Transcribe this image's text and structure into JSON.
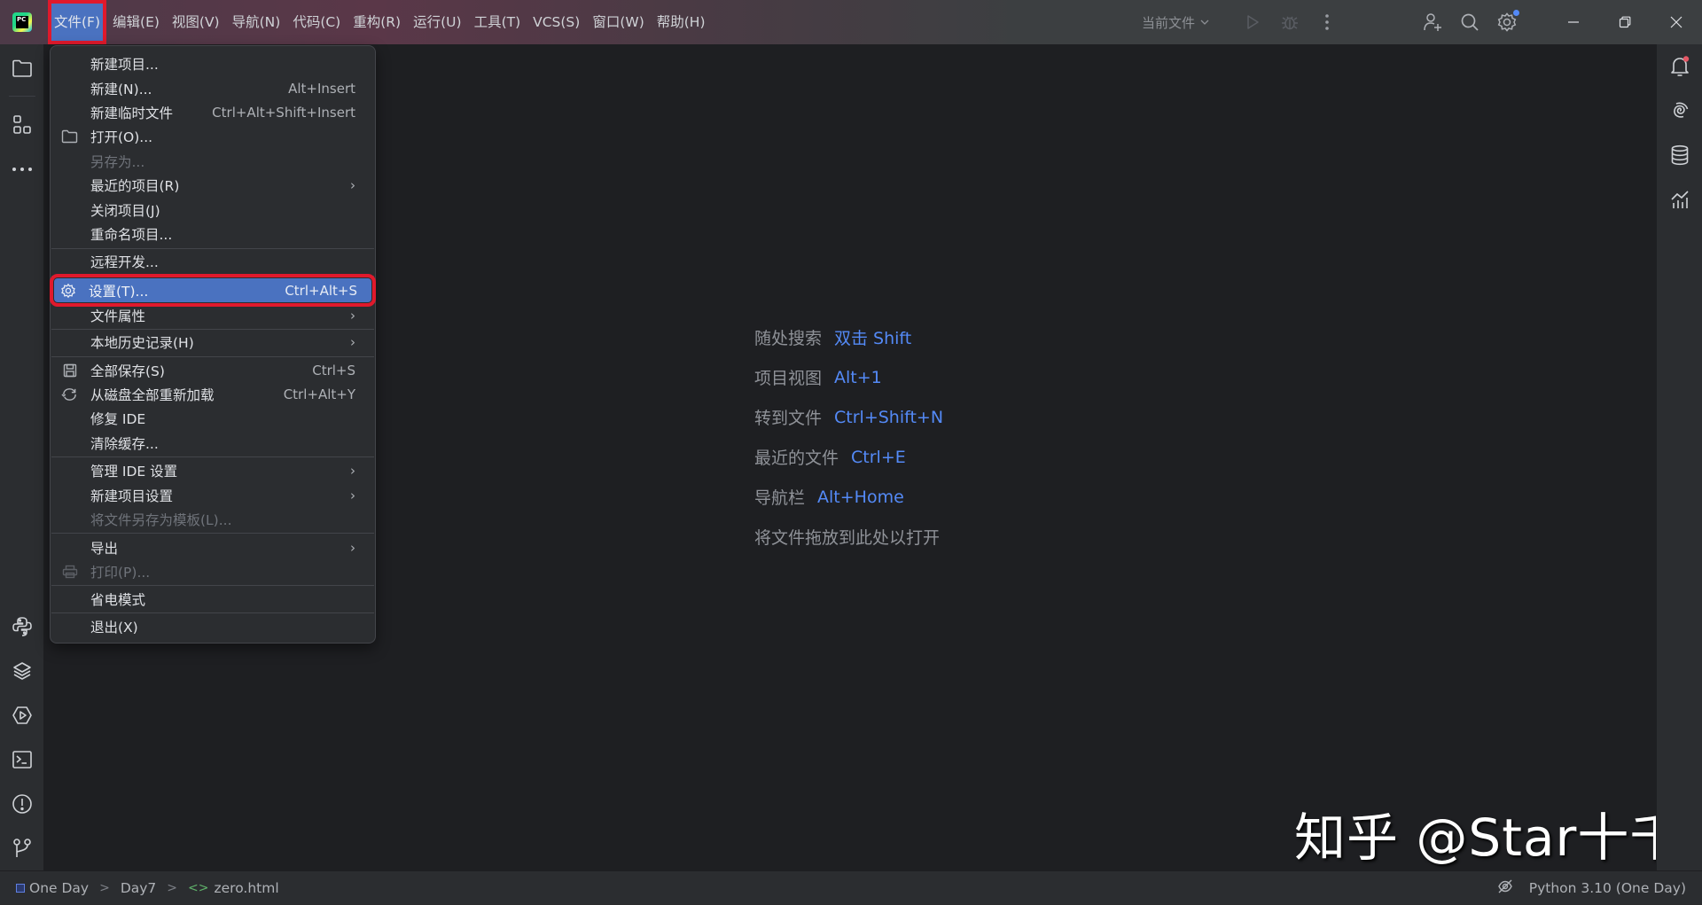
{
  "titlebar": {
    "app_icon": "pycharm-logo-icon",
    "menus": [
      {
        "label": "文件(F)",
        "active": true
      },
      {
        "label": "编辑(E)"
      },
      {
        "label": "视图(V)"
      },
      {
        "label": "导航(N)"
      },
      {
        "label": "代码(C)"
      },
      {
        "label": "重构(R)"
      },
      {
        "label": "运行(U)"
      },
      {
        "label": "工具(T)"
      },
      {
        "label": "VCS(S)"
      },
      {
        "label": "窗口(W)"
      },
      {
        "label": "帮助(H)"
      }
    ],
    "run_config": "当前文件",
    "icons": [
      "run-icon",
      "debug-icon",
      "more-vertical-icon",
      "add-user-icon",
      "search-icon",
      "settings-gear-icon"
    ],
    "window_buttons": [
      "minimize-icon",
      "restore-icon",
      "close-icon"
    ]
  },
  "file_menu": {
    "items": [
      {
        "label": "新建项目...",
        "shortcut": "",
        "icon": "",
        "disabled": false,
        "submenu": false
      },
      {
        "label": "新建(N)...",
        "shortcut": "Alt+Insert",
        "icon": "",
        "disabled": false,
        "submenu": false
      },
      {
        "label": "新建临时文件",
        "shortcut": "Ctrl+Alt+Shift+Insert",
        "icon": "",
        "disabled": false,
        "submenu": false
      },
      {
        "label": "打开(O)...",
        "shortcut": "",
        "icon": "folder-icon",
        "disabled": false,
        "submenu": false
      },
      {
        "label": "另存为...",
        "shortcut": "",
        "icon": "",
        "disabled": true,
        "submenu": false
      },
      {
        "label": "最近的项目(R)",
        "shortcut": "",
        "icon": "",
        "disabled": false,
        "submenu": true
      },
      {
        "label": "关闭项目(J)",
        "shortcut": "",
        "icon": "",
        "disabled": false,
        "submenu": false
      },
      {
        "label": "重命名项目...",
        "shortcut": "",
        "icon": "",
        "disabled": false,
        "submenu": false
      },
      {
        "label": "远程开发...",
        "shortcut": "",
        "icon": "",
        "disabled": false,
        "submenu": false
      },
      {
        "label": "设置(T)...",
        "shortcut": "Ctrl+Alt+S",
        "icon": "gear-icon",
        "disabled": false,
        "submenu": false,
        "selected": true
      },
      {
        "label": "文件属性",
        "shortcut": "",
        "icon": "",
        "disabled": false,
        "submenu": true
      },
      {
        "label": "本地历史记录(H)",
        "shortcut": "",
        "icon": "",
        "disabled": false,
        "submenu": true
      },
      {
        "label": "全部保存(S)",
        "shortcut": "Ctrl+S",
        "icon": "save-icon",
        "disabled": false,
        "submenu": false
      },
      {
        "label": "从磁盘全部重新加载",
        "shortcut": "Ctrl+Alt+Y",
        "icon": "reload-icon",
        "disabled": false,
        "submenu": false
      },
      {
        "label": "修复 IDE",
        "shortcut": "",
        "icon": "",
        "disabled": false,
        "submenu": false
      },
      {
        "label": "清除缓存...",
        "shortcut": "",
        "icon": "",
        "disabled": false,
        "submenu": false
      },
      {
        "label": "管理 IDE 设置",
        "shortcut": "",
        "icon": "",
        "disabled": false,
        "submenu": true
      },
      {
        "label": "新建项目设置",
        "shortcut": "",
        "icon": "",
        "disabled": false,
        "submenu": true
      },
      {
        "label": "将文件另存为模板(L)...",
        "shortcut": "",
        "icon": "",
        "disabled": true,
        "submenu": false
      },
      {
        "label": "导出",
        "shortcut": "",
        "icon": "",
        "disabled": false,
        "submenu": true
      },
      {
        "label": "打印(P)...",
        "shortcut": "",
        "icon": "print-icon",
        "disabled": true,
        "submenu": false
      },
      {
        "label": "省电模式",
        "shortcut": "",
        "icon": "",
        "disabled": false,
        "submenu": false
      },
      {
        "label": "退出(X)",
        "shortcut": "",
        "icon": "",
        "disabled": false,
        "submenu": false
      }
    ],
    "submenu_arrow": "›"
  },
  "left_toolbar": {
    "top": [
      "project-folder-icon",
      "structure-icon",
      "more-horizontal-icon"
    ],
    "bottom": [
      "python-console-icon",
      "python-packages-icon",
      "services-icon",
      "terminal-icon",
      "problems-icon",
      "git-icon"
    ]
  },
  "right_toolbar": [
    "notifications-icon",
    "ai-assistant-icon",
    "database-icon",
    "sciview-icon"
  ],
  "editor": {
    "hints": [
      {
        "label": "随处搜索",
        "key": "双击 Shift"
      },
      {
        "label": "项目视图",
        "key": "Alt+1"
      },
      {
        "label": "转到文件",
        "key": "Ctrl+Shift+N"
      },
      {
        "label": "最近的文件",
        "key": "Ctrl+E"
      },
      {
        "label": "导航栏",
        "key": "Alt+Home"
      },
      {
        "label": "将文件拖放到此处以打开",
        "key": ""
      }
    ]
  },
  "watermark": "知乎 @Star十千",
  "statusbar": {
    "breadcrumbs": [
      "One Day",
      "Day7",
      "zero.html"
    ],
    "interpreter": "Python 3.10 (One Day)"
  },
  "colors": {
    "accent": "#4a72c0",
    "highlight_border": "#e0192c",
    "hint_key": "#548af7"
  }
}
